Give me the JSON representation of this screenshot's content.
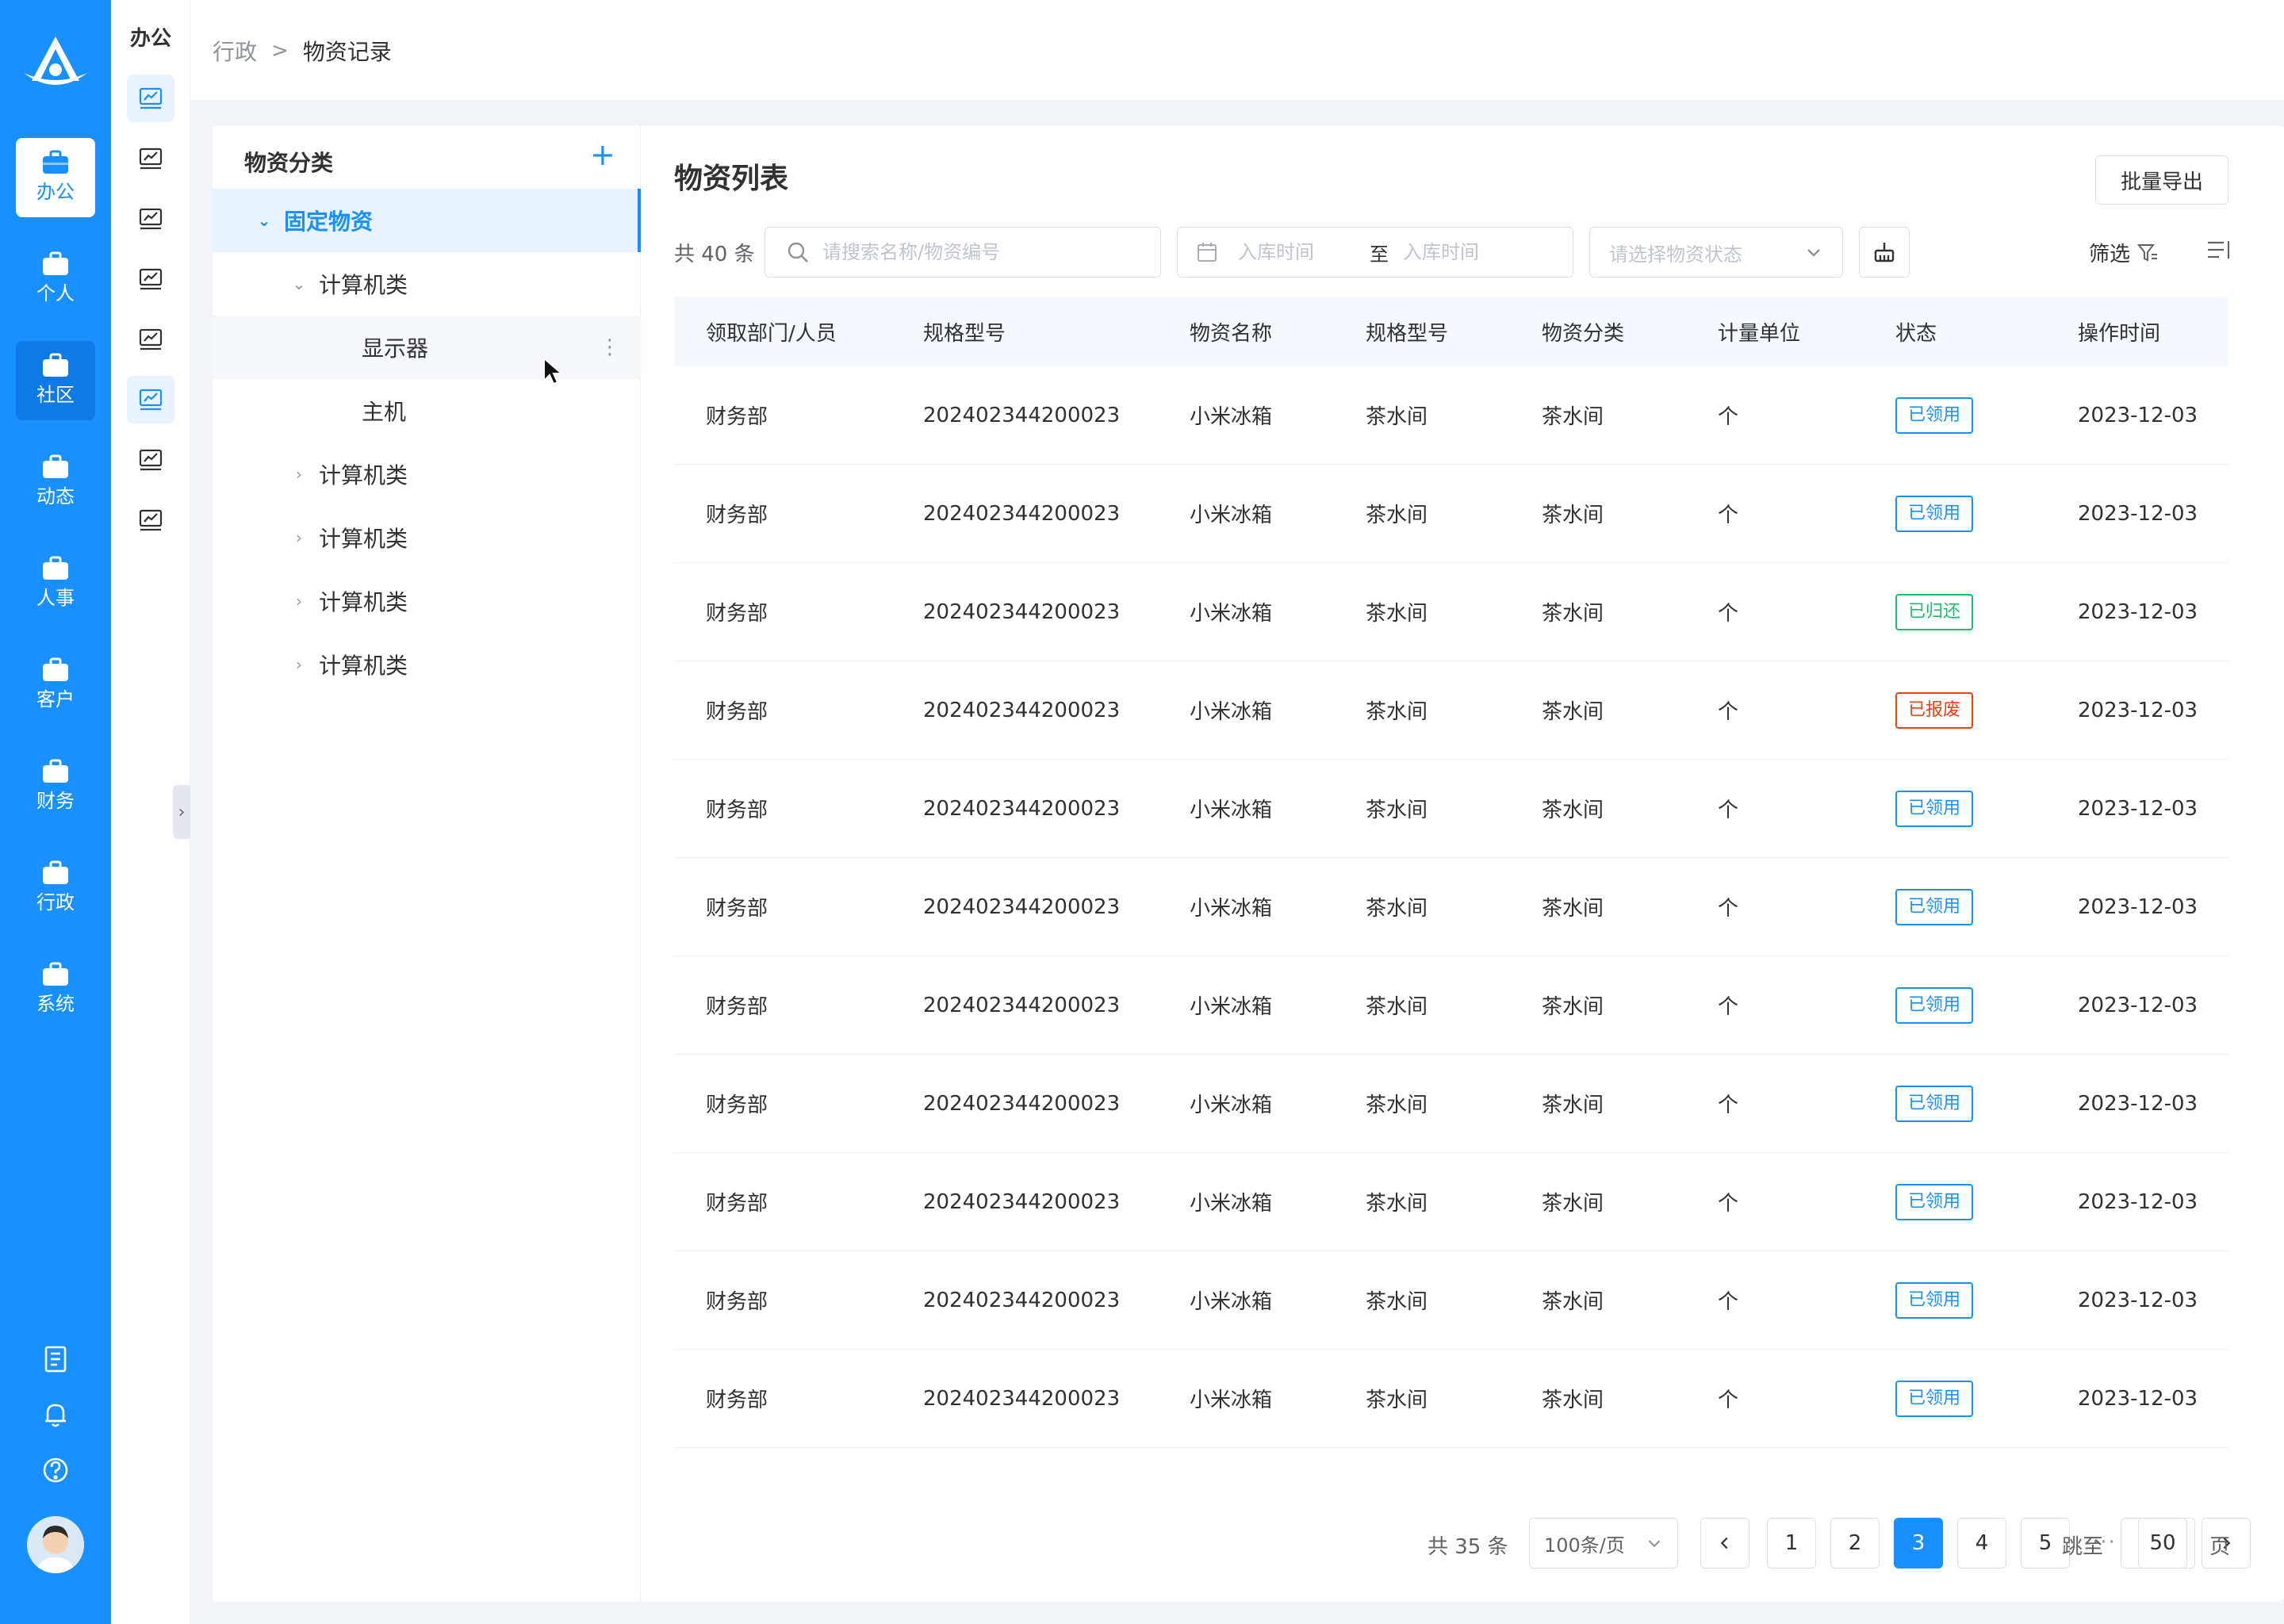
{
  "nav": {
    "items": [
      {
        "label": "办公",
        "active": true
      },
      {
        "label": "个人"
      },
      {
        "label": "社区",
        "hover": true
      },
      {
        "label": "动态"
      },
      {
        "label": "人事"
      },
      {
        "label": "客户"
      },
      {
        "label": "财务"
      },
      {
        "label": "行政"
      },
      {
        "label": "系统"
      }
    ],
    "utilities": [
      "notebook-icon",
      "bell-icon",
      "help-icon"
    ],
    "accent_color": "#1890ff"
  },
  "subnav": {
    "title": "办公",
    "icon": "chart-screen-icon",
    "icon_count": 8,
    "active_indexes": [
      0,
      5
    ]
  },
  "breadcrumb": {
    "parent": "行政",
    "current": "物资记录"
  },
  "category": {
    "title": "物资分类",
    "add_icon": "plus-icon",
    "tree": [
      {
        "label": "固定物资",
        "level": 0,
        "expanded": true,
        "selected": true
      },
      {
        "label": "计算机类",
        "level": 1,
        "expanded": true
      },
      {
        "label": "显示器",
        "level": 2,
        "hovered": true
      },
      {
        "label": "主机",
        "level": 2
      },
      {
        "label": "计算机类",
        "level": 1,
        "expanded": false
      },
      {
        "label": "计算机类",
        "level": 1,
        "expanded": false
      },
      {
        "label": "计算机类",
        "level": 1,
        "expanded": false
      },
      {
        "label": "计算机类",
        "level": 1,
        "expanded": false
      }
    ]
  },
  "list": {
    "title": "物资列表",
    "export_label": "批量导出",
    "total_label": "共 40 条",
    "search_placeholder": "请搜索名称/物资编号",
    "date_start_placeholder": "入库时间",
    "date_separator": "至",
    "date_end_placeholder": "入库时间",
    "status_placeholder": "请选择物资状态",
    "filter_label": "筛选",
    "columns": [
      "领取部门/人员",
      "规格型号",
      "物资名称",
      "规格型号",
      "物资分类",
      "计量单位",
      "状态",
      "操作时间"
    ],
    "rows": [
      {
        "dept": "财务部",
        "spec": "202402344200023",
        "name": "小米冰箱",
        "model": "茶水间",
        "category": "茶水间",
        "unit": "个",
        "status": "已领用",
        "status_color": "blue",
        "time": "2023-12-03"
      },
      {
        "dept": "财务部",
        "spec": "202402344200023",
        "name": "小米冰箱",
        "model": "茶水间",
        "category": "茶水间",
        "unit": "个",
        "status": "已领用",
        "status_color": "blue",
        "time": "2023-12-03"
      },
      {
        "dept": "财务部",
        "spec": "202402344200023",
        "name": "小米冰箱",
        "model": "茶水间",
        "category": "茶水间",
        "unit": "个",
        "status": "已归还",
        "status_color": "green",
        "time": "2023-12-03"
      },
      {
        "dept": "财务部",
        "spec": "202402344200023",
        "name": "小米冰箱",
        "model": "茶水间",
        "category": "茶水间",
        "unit": "个",
        "status": "已报废",
        "status_color": "red",
        "time": "2023-12-03"
      },
      {
        "dept": "财务部",
        "spec": "202402344200023",
        "name": "小米冰箱",
        "model": "茶水间",
        "category": "茶水间",
        "unit": "个",
        "status": "已领用",
        "status_color": "blue",
        "time": "2023-12-03"
      },
      {
        "dept": "财务部",
        "spec": "202402344200023",
        "name": "小米冰箱",
        "model": "茶水间",
        "category": "茶水间",
        "unit": "个",
        "status": "已领用",
        "status_color": "blue",
        "time": "2023-12-03"
      },
      {
        "dept": "财务部",
        "spec": "202402344200023",
        "name": "小米冰箱",
        "model": "茶水间",
        "category": "茶水间",
        "unit": "个",
        "status": "已领用",
        "status_color": "blue",
        "time": "2023-12-03"
      },
      {
        "dept": "财务部",
        "spec": "202402344200023",
        "name": "小米冰箱",
        "model": "茶水间",
        "category": "茶水间",
        "unit": "个",
        "status": "已领用",
        "status_color": "blue",
        "time": "2023-12-03"
      },
      {
        "dept": "财务部",
        "spec": "202402344200023",
        "name": "小米冰箱",
        "model": "茶水间",
        "category": "茶水间",
        "unit": "个",
        "status": "已领用",
        "status_color": "blue",
        "time": "2023-12-03"
      },
      {
        "dept": "财务部",
        "spec": "202402344200023",
        "name": "小米冰箱",
        "model": "茶水间",
        "category": "茶水间",
        "unit": "个",
        "status": "已领用",
        "status_color": "blue",
        "time": "2023-12-03"
      },
      {
        "dept": "财务部",
        "spec": "202402344200023",
        "name": "小米冰箱",
        "model": "茶水间",
        "category": "茶水间",
        "unit": "个",
        "status": "已领用",
        "status_color": "blue",
        "time": "2023-12-03"
      }
    ]
  },
  "pagination": {
    "total_label": "共 35 条",
    "page_size_label": "100条/页",
    "pages": [
      "1",
      "2",
      "3",
      "4",
      "5"
    ],
    "current_page": "3",
    "ellipsis": "···",
    "last_page": "50",
    "jump_label": "跳至",
    "jump_value": "",
    "page_suffix": "页"
  }
}
